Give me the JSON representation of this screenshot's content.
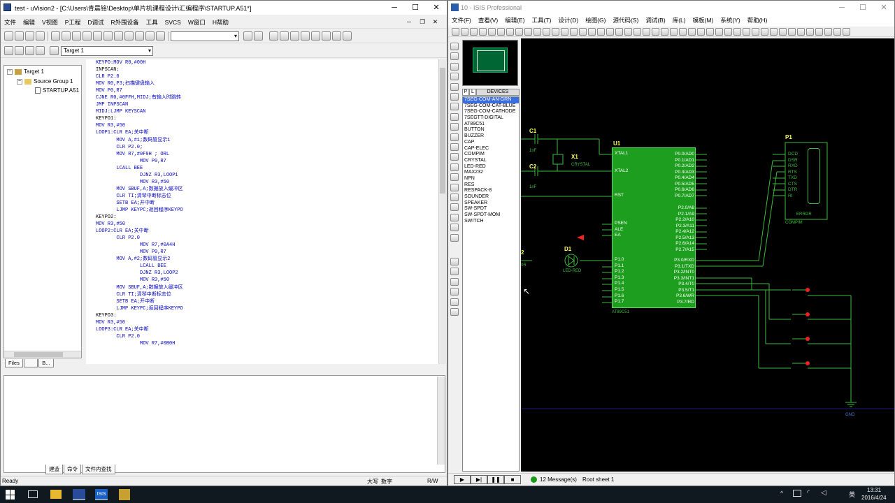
{
  "left_window": {
    "title": "test  - uVision2 - [C:\\Users\\青晨铭\\Desktop\\单片机课程设计\\汇编程序\\STARTUP.A51*]",
    "menu": [
      "文件",
      "编辑",
      "V视图",
      "P工程",
      "D调试",
      "R外围设备",
      "工具",
      "SVCS",
      "W窗口",
      "H帮助"
    ],
    "target_combo": "Target 1",
    "tree": {
      "root": "Target 1",
      "group": "Source Group 1",
      "file": "STARTUP.A51"
    },
    "project_tabs": [
      "Files",
      "",
      "B..."
    ],
    "code_lines": [
      {
        "t": "KEYPO:MOV R0,#00H",
        "c": "k"
      },
      {
        "t": "",
        "c": ""
      },
      {
        "t": "INPSCAN:",
        "c": ""
      },
      {
        "t": "CLR P2.0",
        "c": "k"
      },
      {
        "t": "MOV R0,P3;扫描键盘输入",
        "c": "k"
      },
      {
        "t": "MOV P0,R7",
        "c": "k"
      },
      {
        "t": "CJNE R0,#0FFH,MIDJ;有输入时跳转",
        "c": "k"
      },
      {
        "t": "JMP INPSCAN",
        "c": "k"
      },
      {
        "t": "",
        "c": ""
      },
      {
        "t": "MIDJ:LJMP KEYSCAN",
        "c": "k"
      },
      {
        "t": "",
        "c": ""
      },
      {
        "t": "KEYPO1:",
        "c": ""
      },
      {
        "t": "MOV R3,#50",
        "c": "k"
      },
      {
        "t": "LOOP1:CLR EA;关中断",
        "c": "k"
      },
      {
        "t": "       MOV A,#1;数码管显示1",
        "c": "k"
      },
      {
        "t": "       CLR P2.0;",
        "c": "k"
      },
      {
        "t": "       MOV R7,#0F9H ; ORL",
        "c": "k"
      },
      {
        "t": "               MOV P0,R7",
        "c": "k"
      },
      {
        "t": "       LCALL BEE",
        "c": "k"
      },
      {
        "t": "               DJNZ R3,LOOP1",
        "c": "k"
      },
      {
        "t": "               MOV R3,#50",
        "c": "k"
      },
      {
        "t": "       MOV SBUF,A;数据放入缓冲区",
        "c": "k"
      },
      {
        "t": "       CLR TI;清琴中断标志位",
        "c": "k"
      },
      {
        "t": "       SETB EA;开中断",
        "c": "k"
      },
      {
        "t": "       LJMP KEYPC;返回程序KEYPO",
        "c": "k"
      },
      {
        "t": "KEYPO2:",
        "c": ""
      },
      {
        "t": "MOV R3,#50",
        "c": "k"
      },
      {
        "t": "LOOP2:CLR EA;关中断",
        "c": "k"
      },
      {
        "t": "       CLR P2.0",
        "c": "k"
      },
      {
        "t": "               MOV R7,#0A4H",
        "c": "k"
      },
      {
        "t": "               MOV P0,R7",
        "c": "k"
      },
      {
        "t": "       MOV A,#2;数码管显示2",
        "c": "k"
      },
      {
        "t": "               LCALL BEE",
        "c": "k"
      },
      {
        "t": "               DJNZ R3,LOOP2",
        "c": "k"
      },
      {
        "t": "               MOV R3,#50",
        "c": "k"
      },
      {
        "t": "       MOV SBUF,A;数据放入缓冲区",
        "c": "k"
      },
      {
        "t": "       CLR TI;清琴中断标志位",
        "c": "k"
      },
      {
        "t": "       SETB EA;开中断",
        "c": "k"
      },
      {
        "t": "       LJMP KEYPC;返回程序KEYPO",
        "c": "k"
      },
      {
        "t": "KEYPO3:",
        "c": ""
      },
      {
        "t": "MOV R3,#50",
        "c": "k"
      },
      {
        "t": "LOOP3:CLR EA;关中断",
        "c": "k"
      },
      {
        "t": "       CLR P2.0",
        "c": "k"
      },
      {
        "t": "               MOV R7,#0B0H",
        "c": "k"
      }
    ],
    "output_tabs": [
      "建造",
      "命令",
      "文件内查找"
    ],
    "status": {
      "left": "Ready",
      "caps": "大写",
      "num": "数字",
      "rw": "R/W"
    }
  },
  "right_window": {
    "title": "10 - ISIS Professional",
    "menu": [
      "文件(F)",
      "查看(V)",
      "编辑(E)",
      "工具(T)",
      "设计(D)",
      "绘图(G)",
      "源代码(S)",
      "调试(B)",
      "库(L)",
      "模板(M)",
      "系统(Y)",
      "帮助(H)"
    ],
    "devices_header": "DEVICES",
    "pick_buttons": [
      "P",
      "L"
    ],
    "devices": [
      "7SEG-COM-AN-GRN",
      "7SEG-COM-CAT-BLUE",
      "7SEG-COM-CATHODE",
      "7SEGTT-DIGITAL",
      "AT89C51",
      "BUTTON",
      "BUZZER",
      "CAP",
      "CAP-ELEC",
      "COMPIM",
      "CRYSTAL",
      "LED-RED",
      "MAX232",
      "NPN",
      "RES",
      "RESPACK-8",
      "SOUNDER",
      "SPEAKER",
      "SW-SPDT",
      "SW-SPDT-MOM",
      "SWITCH"
    ],
    "selected_device": 0,
    "status": {
      "messages": "12 Message(s)",
      "sheet": "Root sheet 1"
    },
    "schematic": {
      "u1_ref": "U1",
      "u1_part": "AT89C51",
      "u1_left_pins": [
        "XTAL1",
        "XTAL2",
        "RST",
        "PSEN",
        "ALE",
        "EA",
        "P1.0",
        "P1.1",
        "P1.2",
        "P1.3",
        "P1.4",
        "P1.5",
        "P1.6",
        "P1.7"
      ],
      "u1_right_pins_p0": [
        "P0.0/AD0",
        "P0.1/AD1",
        "P0.2/AD2",
        "P0.3/AD3",
        "P0.4/AD4",
        "P0.5/AD5",
        "P0.6/AD6",
        "P0.7/AD7"
      ],
      "u1_right_pins_p2": [
        "P2.0/A8",
        "P2.1/A9",
        "P2.2/A10",
        "P2.3/A11",
        "P2.4/A12",
        "P2.5/A13",
        "P2.6/A14",
        "P2.7/A15"
      ],
      "u1_right_pins_p3": [
        "P3.0/RXD",
        "P3.1/TXD",
        "P3.2/INT0",
        "P3.3/INT1",
        "P3.4/T0",
        "P3.5/T1",
        "P3.6/WR",
        "P3.7/RD"
      ],
      "c1": "C1",
      "c1_val": "1nF",
      "c2": "C2",
      "c2_val": "1nF",
      "x1": "X1",
      "x1_part": "CRYSTAL",
      "d1": "D1",
      "d1_part": "LED-RED",
      "p1": "P1",
      "p1_part": "COMPIM",
      "p1_err": "ERROR",
      "p1_pins": [
        "DCD",
        "DSR",
        "RXD",
        "RTS",
        "TXD",
        "CTS",
        "DTR",
        "RI"
      ],
      "gnd": "GND",
      "r_label": "2",
      "r_val": "0R"
    }
  },
  "taskbar": {
    "time": "13:31",
    "date": "2016/4/24",
    "ime": "英"
  }
}
